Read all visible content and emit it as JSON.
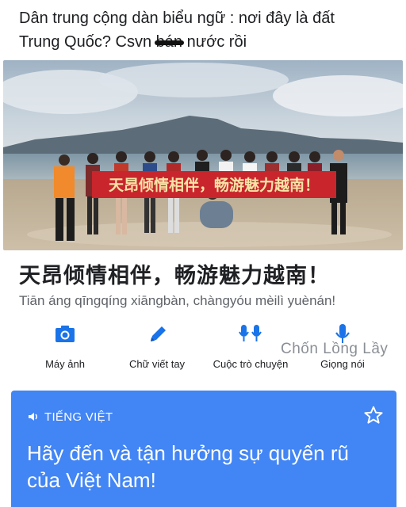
{
  "post": {
    "caption_line1": "Dân trung cộng dàn biểu ngữ : nơi đây là đất",
    "caption_line2_start": "Trung Quốc?  Csvn ",
    "caption_struck": "bán",
    "caption_line2_end": " nước rồi"
  },
  "photo": {
    "banner_text": "天昂倾情相伴，畅游魅力越南！"
  },
  "translate": {
    "source_text": "天昂倾情相伴，畅游魅力越南！",
    "pinyin": "Tiān áng qīngqíng xiāngbàn, chàngyóu mèilì yuènán!",
    "tools": [
      {
        "label": "Máy ảnh",
        "icon": "camera-icon"
      },
      {
        "label": "Chữ viết tay",
        "icon": "pen-icon"
      },
      {
        "label": "Cuộc trò chuyện",
        "icon": "conversation-icon"
      },
      {
        "label": "Giọng nói",
        "icon": "microphone-icon"
      }
    ],
    "target_language": "TIẾNG VIỆT",
    "translation": "Hãy đến và tận hưởng sự quyến rũ của Việt Nam!",
    "accent_color": "#4285f4",
    "icon_color": "#1a73e8"
  },
  "watermark": "Chốn Lồng Lầy"
}
